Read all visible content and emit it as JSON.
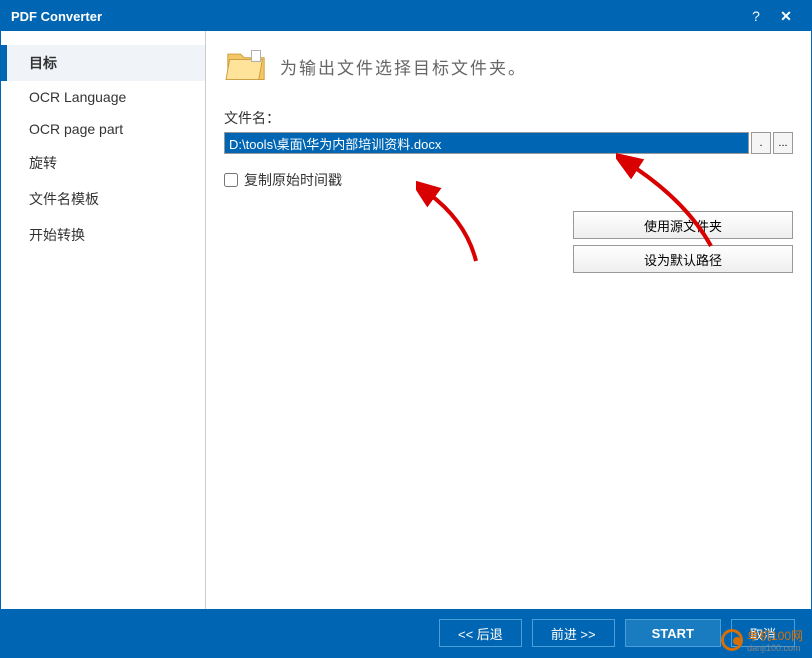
{
  "titlebar": {
    "title": "PDF Converter"
  },
  "sidebar": {
    "items": [
      {
        "label": "目标",
        "active": true
      },
      {
        "label": "OCR Language",
        "active": false
      },
      {
        "label": "OCR page part",
        "active": false
      },
      {
        "label": "旋转",
        "active": false
      },
      {
        "label": "文件名模板",
        "active": false
      },
      {
        "label": "开始转换",
        "active": false
      }
    ]
  },
  "main": {
    "heading": "为输出文件选择目标文件夹。",
    "filename_label": "文件名：",
    "path_value": "D:\\tools\\桌面\\华为内部培训资料.docx",
    "clear_btn": ".",
    "browse_btn": "...",
    "checkbox_label": "复制原始时间戳",
    "use_source_btn": "使用源文件夹",
    "set_default_btn": "设为默认路径"
  },
  "footer": {
    "back": "<< 后退",
    "forward": "前进 >>",
    "start": "START",
    "cancel": "取消"
  },
  "watermark": {
    "name": "单机100网",
    "domain": "danji100.com"
  }
}
